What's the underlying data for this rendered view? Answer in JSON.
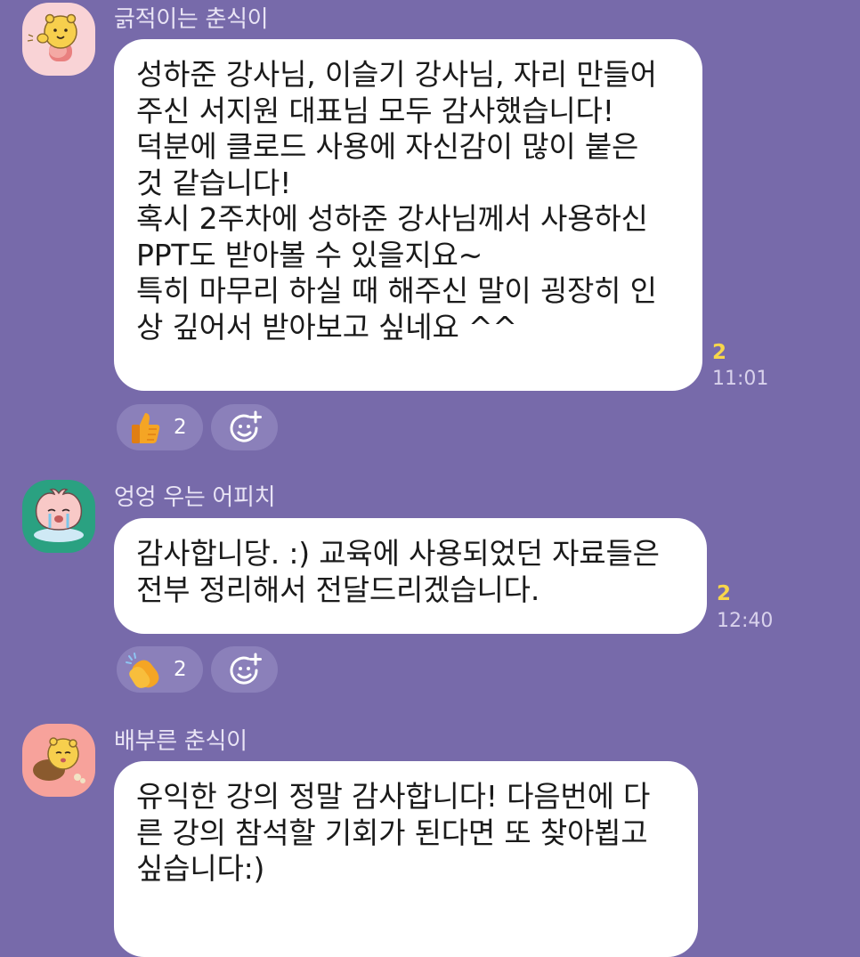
{
  "messages": [
    {
      "sender": "긁적이는 춘식이",
      "lines": [
        "성하준 강사님, 이슬기 강사님, 자리 만들어",
        "주신 서지원 대표님 모두 감사했습니다!",
        "덕분에 클로드 사용에 자신감이 많이 붙은",
        "것 같습니다!",
        "혹시 2주차에 성하준 강사님께서 사용하신",
        "PPT도 받아볼 수 있을지요~",
        "특히 마무리 하실 때 해주신 말이 굉장히 인",
        "상 깊어서 받아보고 싶네요 ^^"
      ],
      "unread": "2",
      "time": "11:01",
      "reaction": {
        "emoji": "thumbs-up-icon",
        "count": "2"
      }
    },
    {
      "sender": "엉엉 우는 어피치",
      "lines": [
        "감사합니당. :) 교육에 사용되었던 자료들은",
        "전부 정리해서 전달드리겠습니다."
      ],
      "unread": "2",
      "time": "12:40",
      "reaction": {
        "emoji": "clapping-hands-icon",
        "count": "2"
      }
    },
    {
      "sender": "배부른 춘식이",
      "lines": [
        "유익한 강의 정말 감사합니다! 다음번에 다",
        "른 강의 참석할 기회가 된다면 또 찾아뵙고",
        "싶습니다:)"
      ]
    }
  ],
  "colors": {
    "background": "#776AAA",
    "bubble": "#FFFFFF",
    "unread": "#F7D64A",
    "reaction_pill": "#8B80BA"
  }
}
